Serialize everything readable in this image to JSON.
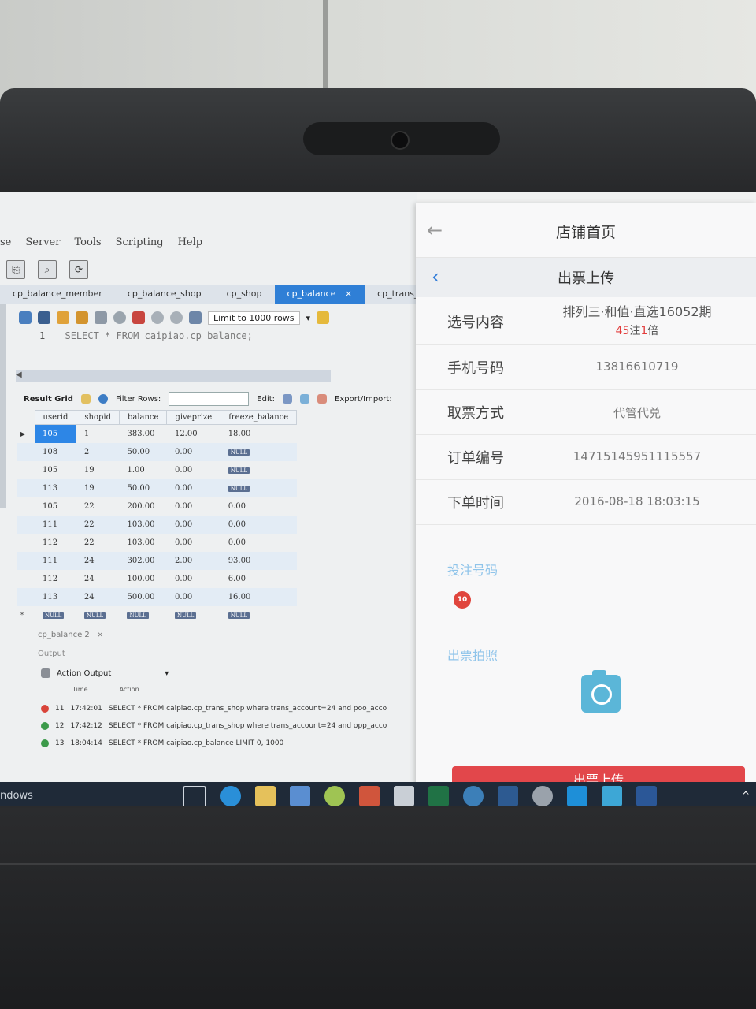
{
  "workbench": {
    "menu": [
      "se",
      "Server",
      "Tools",
      "Scripting",
      "Help"
    ],
    "tabs": [
      {
        "label": "cp_balance_member",
        "active": false
      },
      {
        "label": "cp_balance_shop",
        "active": false
      },
      {
        "label": "cp_shop",
        "active": false
      },
      {
        "label": "cp_balance",
        "active": true
      },
      {
        "label": "cp_trans_n",
        "active": false
      }
    ],
    "tab_close": "×",
    "limit_label": "Limit to 1000 rows",
    "sql": {
      "line": "1",
      "text": "SELECT * FROM caipiao.cp_balance;"
    },
    "grid_toolbar": {
      "result_grid": "Result Grid",
      "filter_rows": "Filter Rows:",
      "edit": "Edit:",
      "export": "Export/Import:"
    },
    "grid": {
      "columns": [
        "userid",
        "shopid",
        "balance",
        "giveprize",
        "freeze_balance"
      ],
      "rows": [
        [
          "105",
          "1",
          "383.00",
          "12.00",
          "18.00"
        ],
        [
          "108",
          "2",
          "50.00",
          "0.00",
          "NULL"
        ],
        [
          "105",
          "19",
          "1.00",
          "0.00",
          "NULL"
        ],
        [
          "113",
          "19",
          "50.00",
          "0.00",
          "NULL"
        ],
        [
          "105",
          "22",
          "200.00",
          "0.00",
          "0.00"
        ],
        [
          "111",
          "22",
          "103.00",
          "0.00",
          "0.00"
        ],
        [
          "112",
          "22",
          "103.00",
          "0.00",
          "0.00"
        ],
        [
          "111",
          "24",
          "302.00",
          "2.00",
          "93.00"
        ],
        [
          "112",
          "24",
          "100.00",
          "0.00",
          "6.00"
        ],
        [
          "113",
          "24",
          "500.00",
          "0.00",
          "16.00"
        ],
        [
          "NULL",
          "NULL",
          "NULL",
          "NULL",
          "NULL"
        ]
      ]
    },
    "result_tab": "cp_balance 2",
    "output_label": "Output",
    "action_output": "Action Output",
    "output_columns": [
      "Time",
      "Action"
    ],
    "log": [
      {
        "status": "error",
        "num": "11",
        "time": "17:42:01",
        "action": "SELECT * FROM caipiao.cp_trans_shop where trans_account=24 and poo_acco"
      },
      {
        "status": "ok",
        "num": "12",
        "time": "17:42:12",
        "action": "SELECT * FROM caipiao.cp_trans_shop where trans_account=24 and opp_acco"
      },
      {
        "status": "ok",
        "num": "13",
        "time": "18:04:14",
        "action": "SELECT * FROM caipiao.cp_balance LIMIT 0, 1000"
      }
    ]
  },
  "app": {
    "header_title": "店铺首页",
    "sub_title": "出票上传",
    "fields": {
      "selection": {
        "label": "选号内容",
        "value1": "排列三·和值·直选16052期",
        "count": "45",
        "count_suffix": "注",
        "multiple": "1",
        "multiple_suffix": "倍"
      },
      "phone": {
        "label": "手机号码",
        "value": "13816610719"
      },
      "pickup": {
        "label": "取票方式",
        "value": "代管代兑"
      },
      "order": {
        "label": "订单编号",
        "value": "14715145951115557"
      },
      "time": {
        "label": "下单时间",
        "value": "2016-08-18 18:03:15"
      }
    },
    "bet_numbers_label": "投注号码",
    "badge": "10",
    "photo_label": "出票拍照",
    "submit_label": "出票上传"
  },
  "taskbar": {
    "left_text": "ndows"
  },
  "colors": {
    "accent_blue": "#2f7fd6",
    "app_red": "#e2474b",
    "link_blue": "#8fc4ea"
  }
}
